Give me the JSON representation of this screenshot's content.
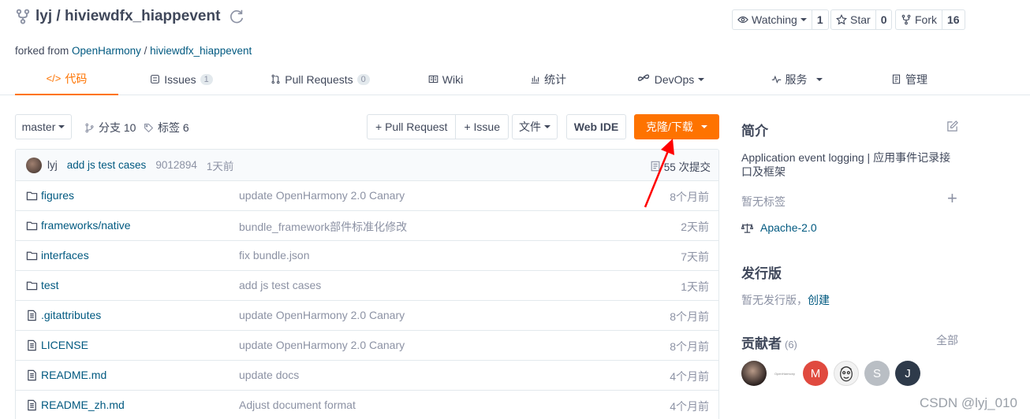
{
  "repo": {
    "owner": "lyj",
    "separator": "/",
    "name": "hiviewdfx_hiappevent",
    "title": "lyj / hiviewdfx_hiappevent",
    "forked_prefix": "forked from",
    "forked_owner": "OpenHarmony",
    "forked_sep": "/",
    "forked_repo": "hiviewdfx_hiappevent"
  },
  "social": {
    "watch_label": "Watching",
    "watch_count": "1",
    "star_label": "Star",
    "star_count": "0",
    "fork_label": "Fork",
    "fork_count": "16"
  },
  "tabs": [
    {
      "label": "代码",
      "active": true
    },
    {
      "label": "Issues",
      "badge": "1"
    },
    {
      "label": "Pull Requests",
      "badge": "0"
    },
    {
      "label": "Wiki"
    },
    {
      "label": "统计"
    },
    {
      "label": "DevOps"
    },
    {
      "label": "服务"
    },
    {
      "label": "管理"
    }
  ],
  "toolbar": {
    "branch": "master",
    "branches": "分支 10",
    "tags": "标签 6",
    "pull_request": "+ Pull Request",
    "issue": "+ Issue",
    "file": "文件",
    "web_ide": "Web IDE",
    "clone": "克隆/下载"
  },
  "commit": {
    "author": "lyj",
    "message": "add js test cases",
    "sha": "9012894",
    "time": "1天前",
    "count": "55 次提交"
  },
  "files": [
    {
      "type": "folder",
      "name": "figures",
      "message": "update OpenHarmony 2.0 Canary",
      "time": "8个月前"
    },
    {
      "type": "folder",
      "name": "frameworks/native",
      "message": "bundle_framework部件标准化修改",
      "time": "2天前"
    },
    {
      "type": "folder",
      "name": "interfaces",
      "message": "fix bundle.json",
      "time": "7天前"
    },
    {
      "type": "folder",
      "name": "test",
      "message": "add js test cases",
      "time": "1天前"
    },
    {
      "type": "file",
      "name": ".gitattributes",
      "message": "update OpenHarmony 2.0 Canary",
      "time": "8个月前"
    },
    {
      "type": "file",
      "name": "LICENSE",
      "message": "update OpenHarmony 2.0 Canary",
      "time": "8个月前"
    },
    {
      "type": "file",
      "name": "README.md",
      "message": "update docs",
      "time": "4个月前"
    },
    {
      "type": "file",
      "name": "README_zh.md",
      "message": "Adjust document format",
      "time": "4个月前"
    }
  ],
  "sidebar": {
    "intro_title": "简介",
    "description_line1": "Application event logging | 应用事件记录接",
    "description_line2": "口及框架",
    "no_tags": "暂无标签",
    "license": "Apache-2.0",
    "release_title": "发行版",
    "no_release": "暂无发行版，",
    "create": "创建",
    "contributors_title": "贡献者",
    "contributors_count": "(6)",
    "all": "全部",
    "avatars": [
      {
        "kind": "photo"
      },
      {
        "kind": "openharmony-logo",
        "text": "OpenHarmony"
      },
      {
        "kind": "letter",
        "text": "M",
        "color": "#e04a3f"
      },
      {
        "kind": "cartoon"
      },
      {
        "kind": "letter",
        "text": "S",
        "color": "#b9bec4"
      },
      {
        "kind": "letter",
        "text": "J",
        "color": "#2e3a4a"
      }
    ]
  },
  "watermark": "CSDN @lyj_010",
  "colors": {
    "accent": "#fe7300",
    "link": "#005980",
    "text": "#40485b",
    "muted": "#8c92a4",
    "annotation_arrow": "#ff0000"
  }
}
